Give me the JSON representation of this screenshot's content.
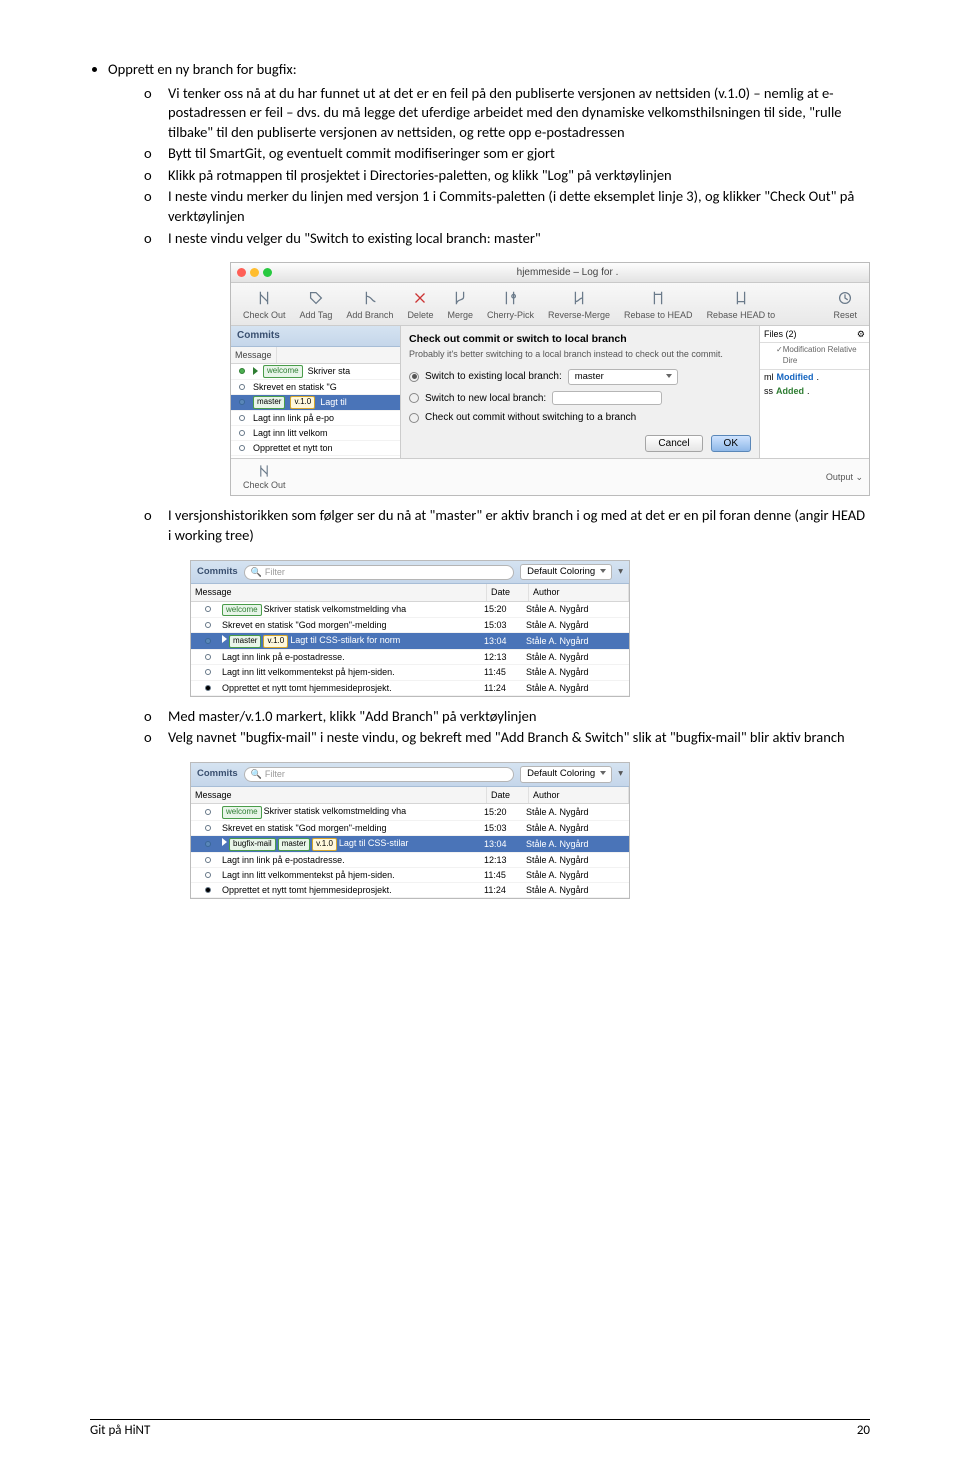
{
  "top_heading": "Opprett en ny branch for bugfix:",
  "sub1": {
    "0": "Vi tenker oss nå at du har funnet ut at det er en feil på den publiserte versjonen av nettsiden (v.1.0) – nemlig at e-postadressen er feil – dvs. du må legge det uferdige arbeidet med den dynamiske velkomsthilsningen til side, \"rulle tilbake\" til den publiserte versjonen av nettsiden, og rette opp e-postadressen",
    "1": "Bytt til SmartGit, og eventuelt commit modifiseringer som er gjort",
    "2": "Klikk på rotmappen til prosjektet i Directories-paletten, og klikk \"Log\" på verktøylinjen",
    "3": "I neste vindu merker du linjen med versjon 1 i Commits-paletten (i dette eksemplet linje 3), og klikker \"Check Out\" på verktøylinjen",
    "4": "I neste vindu velger du \"Switch to existing local branch: master\""
  },
  "sub2": {
    "0": "I versjonshistorikken som følger ser du nå at \"master\" er aktiv branch i og med at det er en pil foran denne (angir HEAD i working tree)"
  },
  "sub3": {
    "0": "Med master/v.1.0 markert, klikk \"Add Branch\" på verktøylinjen",
    "1": "Velg navnet \"bugfix-mail\" i neste vindu, og bekreft med \"Add Branch & Switch\" slik at \"bugfix-mail\" blir aktiv branch"
  },
  "bullet_o": "o",
  "shot1": {
    "window_title": "hjemmeside – Log for .",
    "toolbar": {
      "checkout": "Check Out",
      "addtag": "Add Tag",
      "addbranch": "Add Branch",
      "delete": "Delete",
      "merge": "Merge",
      "cherry": "Cherry-Pick",
      "revmerge": "Reverse-Merge",
      "rebase": "Rebase to HEAD",
      "rebase2": "Rebase HEAD to",
      "reset": "Reset"
    },
    "commits_label": "Commits",
    "col_message": "Message",
    "rows": {
      "0": {
        "tag_welcome": "welcome",
        "txt": "Skriver sta"
      },
      "1": {
        "txt": "Skrevet en statisk \"G"
      },
      "2": {
        "tag_master": "master",
        "tag_ver": "v.1.0",
        "txt": "Lagt til"
      },
      "3": {
        "txt": "Lagt inn link på e-po"
      },
      "4": {
        "txt": "Lagt inn litt velkom"
      },
      "5": {
        "txt": "Opprettet et nytt ton"
      }
    },
    "dialog": {
      "title": "Check out commit or switch to local branch",
      "body": "Probably it's better switching to a local branch instead to check out the commit.",
      "opt1": "Switch to existing local branch:",
      "opt1_val": "master",
      "opt2": "Switch to new local branch:",
      "opt3": "Check out commit without switching to a branch",
      "cancel": "Cancel",
      "ok": "OK"
    },
    "files": {
      "header": "Files (2)",
      "col": "Modification  Relative Dire",
      "r0": {
        "name": "ml",
        "state": "Modified",
        "dot": "."
      },
      "r1": {
        "name": "ss",
        "state": "Added",
        "dot": "."
      }
    },
    "output": "Output",
    "footer_checkout": "Check Out"
  },
  "commits_list": {
    "header": "Commits",
    "filter_ph": "Filter",
    "coloring": "Default Coloring",
    "col_msg": "Message",
    "col_date": "Date",
    "col_author": "Author",
    "author": "Ståle A. Nygård",
    "times": {
      "0": "15:20",
      "1": "15:03",
      "2": "13:04",
      "3": "12:13",
      "4": "11:45",
      "5": "11:24"
    },
    "rows": {
      "0": {
        "tag": "welcome",
        "txt": "Skriver statisk velkomstmelding vha"
      },
      "1": {
        "txt": "Skrevet en statisk \"God morgen\"-melding"
      },
      "2": {
        "tag1": "master",
        "tag2": "v.1.0",
        "txt": "Lagt til CSS-stilark for norm"
      },
      "3": {
        "txt": "Lagt inn link på e-postadresse."
      },
      "4": {
        "txt": "Lagt inn litt velkommentekst på hjem-siden."
      },
      "5": {
        "txt": "Opprettet et nytt tomt hjemmesideprosjekt."
      }
    }
  },
  "commits_list2": {
    "rows": {
      "2": {
        "tag0": "bugfix-mail",
        "tag1": "master",
        "tag2": "v.1.0",
        "txt": "Lagt til CSS-stilar"
      }
    }
  },
  "footer": {
    "left": "Git på HiNT",
    "right": "20"
  }
}
